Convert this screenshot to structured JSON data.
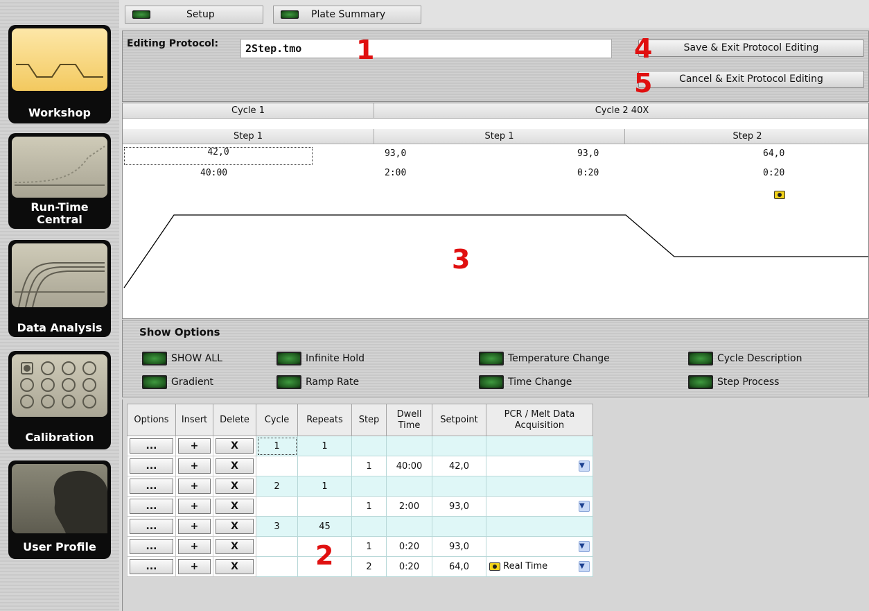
{
  "sidebar": {
    "items": [
      {
        "label": "Workshop"
      },
      {
        "label": "Run-Time Central"
      },
      {
        "label": "Data Analysis"
      },
      {
        "label": "Calibration"
      },
      {
        "label": "User Profile"
      }
    ]
  },
  "tabs": {
    "setup": "Setup",
    "plate_summary": "Plate Summary"
  },
  "editing": {
    "label": "Editing Protocol:",
    "protocol_name": "2Step.tmo",
    "save_label": "Save & Exit Protocol Editing",
    "cancel_label": "Cancel & Exit Protocol Editing"
  },
  "callouts": {
    "c1": "1",
    "c2": "2",
    "c3": "3",
    "c4": "4",
    "c5": "5"
  },
  "graph": {
    "cycle1": {
      "label": "Cycle 1",
      "step1": {
        "label": "Step 1",
        "temp": "42,0",
        "time": "40:00"
      }
    },
    "cycle2": {
      "label": "Cycle 2 40X",
      "step1": {
        "label": "Step 1",
        "temp_start": "93,0",
        "temp_end": "93,0",
        "time_start": "2:00",
        "time_end": "0:20"
      },
      "step2": {
        "label": "Step 2",
        "temp": "64,0",
        "time": "0:20"
      }
    }
  },
  "options": {
    "title": "Show Options",
    "items": [
      "SHOW ALL",
      "Infinite Hold",
      "Temperature Change",
      "Cycle Description",
      "Gradient",
      "Ramp Rate",
      "Time Change",
      "Step Process"
    ]
  },
  "table": {
    "headers": {
      "options": "Options",
      "insert": "Insert",
      "delete": "Delete",
      "cycle": "Cycle",
      "repeats": "Repeats",
      "step": "Step",
      "dwell": "Dwell Time",
      "setpoint": "Setpoint",
      "acq": "PCR / Melt Data Acquisition"
    },
    "button_labels": {
      "options": "...",
      "insert": "+",
      "delete": "X"
    },
    "rows": [
      {
        "cycle": "1",
        "repeats": "1",
        "step": "",
        "dwell": "",
        "setpoint": "",
        "acq": "",
        "kind": "cycle"
      },
      {
        "cycle": "",
        "repeats": "",
        "step": "1",
        "dwell": "40:00",
        "setpoint": "42,0",
        "acq": "",
        "kind": "step"
      },
      {
        "cycle": "2",
        "repeats": "1",
        "step": "",
        "dwell": "",
        "setpoint": "",
        "acq": "",
        "kind": "cycle"
      },
      {
        "cycle": "",
        "repeats": "",
        "step": "1",
        "dwell": "2:00",
        "setpoint": "93,0",
        "acq": "",
        "kind": "step"
      },
      {
        "cycle": "3",
        "repeats": "45",
        "step": "",
        "dwell": "",
        "setpoint": "",
        "acq": "",
        "kind": "cycle"
      },
      {
        "cycle": "",
        "repeats": "",
        "step": "1",
        "dwell": "0:20",
        "setpoint": "93,0",
        "acq": "",
        "kind": "step"
      },
      {
        "cycle": "",
        "repeats": "",
        "step": "2",
        "dwell": "0:20",
        "setpoint": "64,0",
        "acq": "Real Time",
        "kind": "step"
      }
    ]
  }
}
